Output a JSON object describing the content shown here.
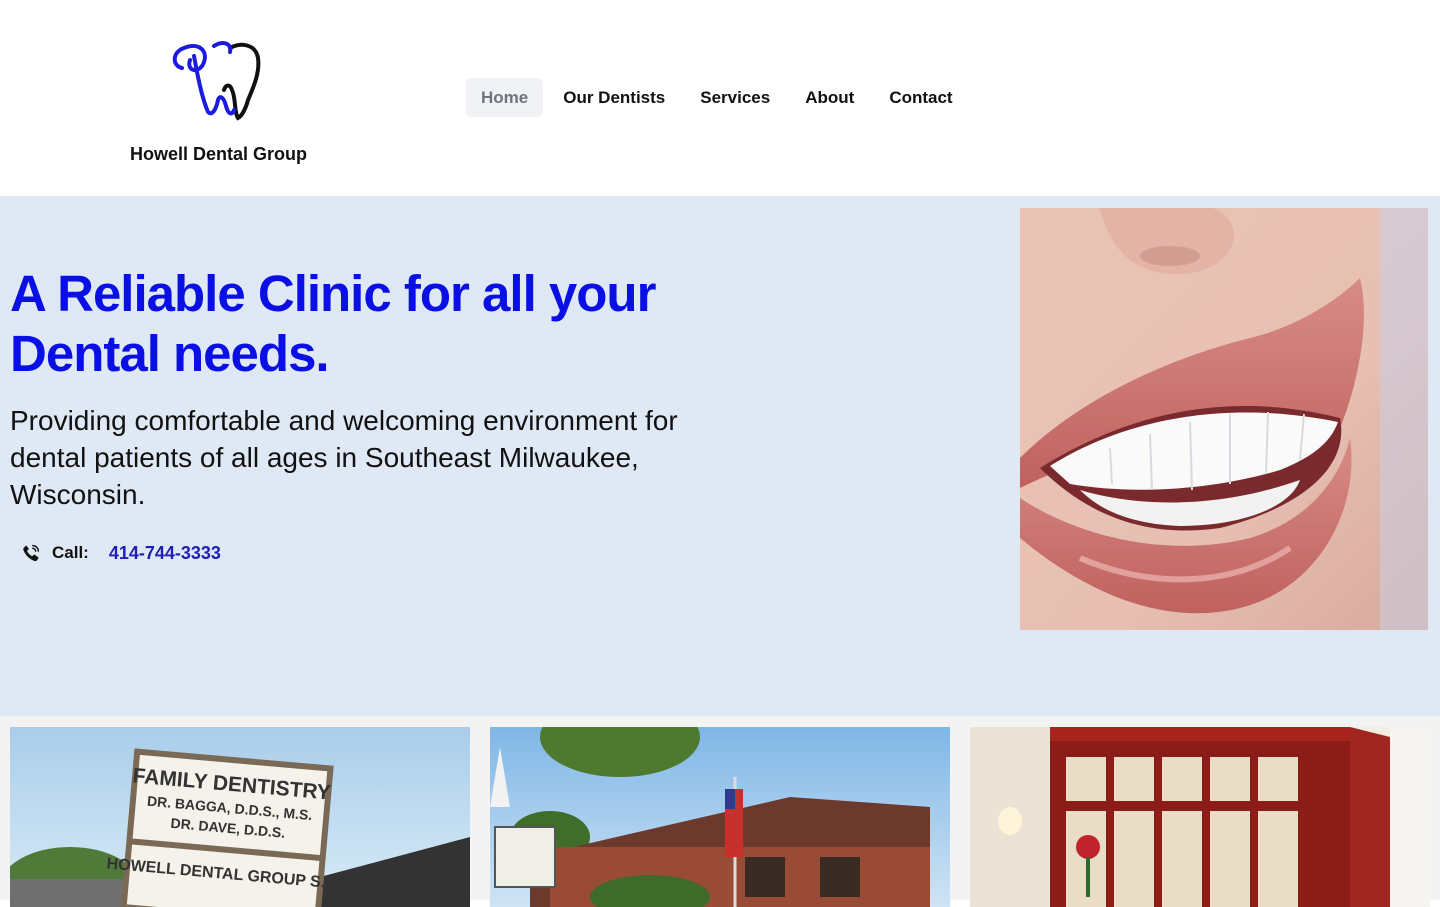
{
  "brand": {
    "name": "Howell Dental Group",
    "logo_icon": "tooth-logo-icon"
  },
  "nav": {
    "items": [
      {
        "label": "Home",
        "active": true
      },
      {
        "label": "Our Dentists",
        "active": false
      },
      {
        "label": "Services",
        "active": false
      },
      {
        "label": "About",
        "active": false
      },
      {
        "label": "Contact",
        "active": false
      }
    ]
  },
  "hero": {
    "title": "A Reliable Clinic for all your Dental needs.",
    "subtitle": "Providing comfortable and welcoming environment for dental patients of all ages in Southeast Milwaukee, Wisconsin.",
    "call_label": "Call:",
    "phone": "414-744-3333",
    "phone_icon": "phone-icon",
    "image": "smiling-teeth-photo"
  },
  "gallery": {
    "images": [
      "building-sign-photo",
      "clinic-building-photo",
      "reception-desk-photo"
    ],
    "sign_lines": [
      "FAMILY DENTISTRY",
      "DR. BAGGA, D.D.S., M.S.",
      "DR. DAVE, D.D.S.",
      "HOWELL DENTAL GROUP S.C."
    ]
  },
  "colors": {
    "accent": "#0a0fe6",
    "hero_bg": "#dfe9f5",
    "phone": "#1f1fb5"
  }
}
